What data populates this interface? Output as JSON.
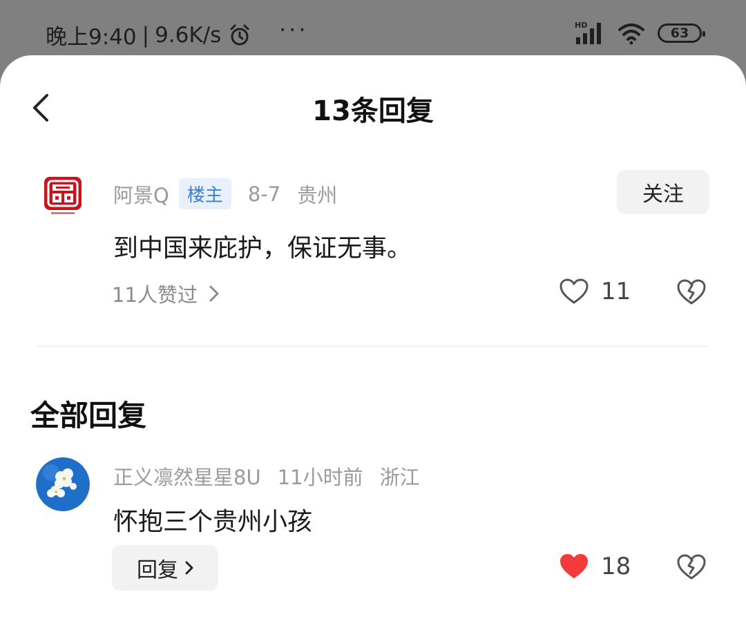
{
  "status": {
    "time": "晚上9:40",
    "speed": "9.6K/s",
    "separator": "|",
    "network": "HD",
    "battery": "63",
    "dots": "···"
  },
  "header": {
    "title": "13条回复"
  },
  "post": {
    "author": "阿景Q",
    "badge": "楼主",
    "date": "8-7",
    "location": "贵州",
    "follow_label": "关注",
    "text": "到中国来庇护，保证无事。",
    "likers": "11人赞过",
    "likes": "11"
  },
  "section": {
    "title": "全部回复"
  },
  "replies": [
    {
      "author": "正义凛然星星8U",
      "time": "11小时前",
      "location": "浙江",
      "text": "怀抱三个贵州小孩",
      "reply_label": "回复",
      "likes": "18",
      "liked": true
    }
  ],
  "colors": {
    "like_red": "#f33b3b",
    "op_badge_bg": "#e7f0fb",
    "op_badge_text": "#3b7fd8"
  },
  "icons": [
    "back-icon",
    "alarm-icon",
    "signal-icon",
    "wifi-icon",
    "heart-icon",
    "dislike-icon",
    "chevron-right-icon"
  ]
}
